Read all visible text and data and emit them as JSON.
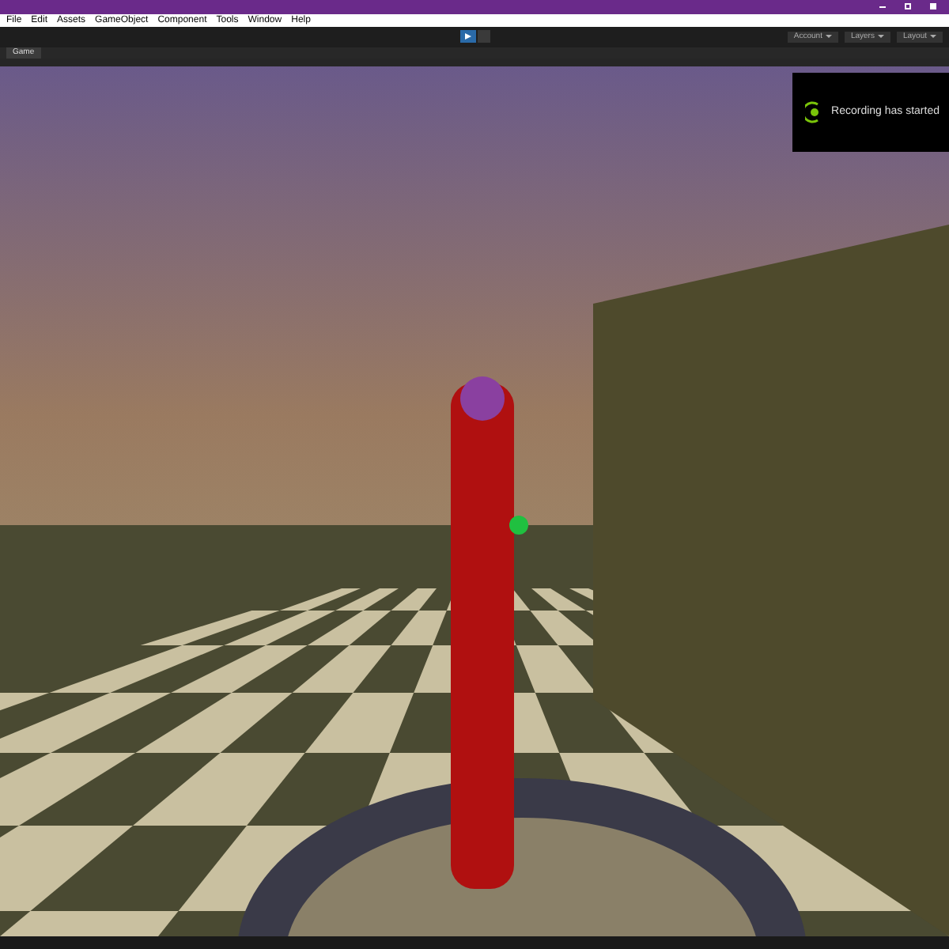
{
  "menu": [
    "File",
    "Edit",
    "Assets",
    "GameObject",
    "Component",
    "Tools",
    "Window",
    "Help"
  ],
  "toolbar": {
    "play_selected": true,
    "right_buttons": [
      "Account",
      "Layers",
      "Layout"
    ]
  },
  "tabs": [
    {
      "label": "Game",
      "selected": true
    }
  ],
  "notification": {
    "text": "Recording has started"
  }
}
